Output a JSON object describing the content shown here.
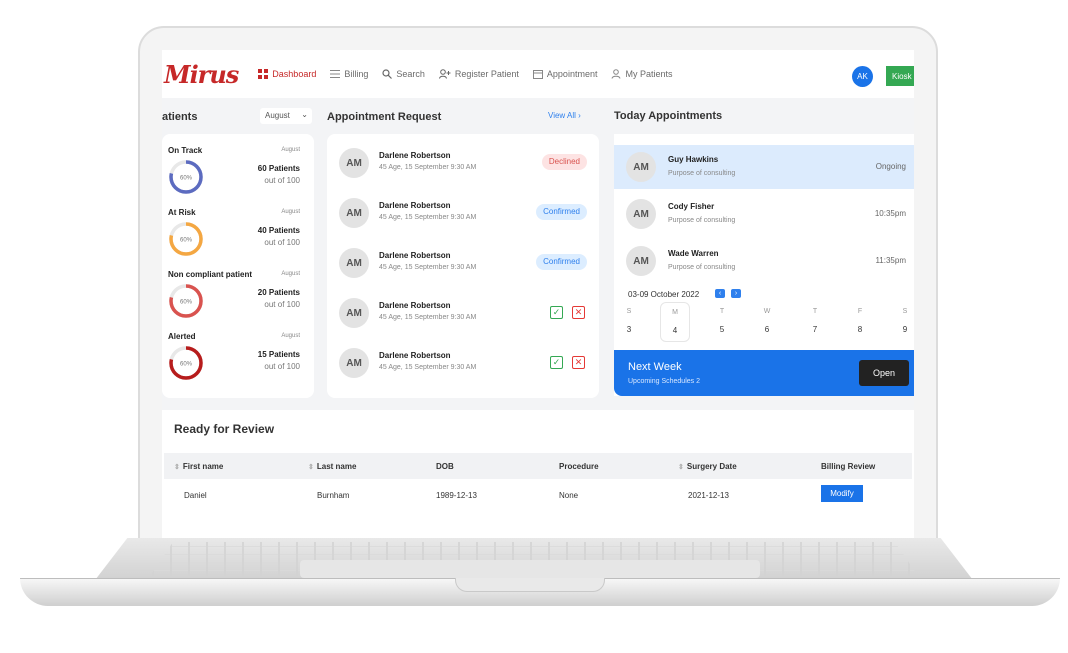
{
  "app": {
    "logo": "Mirus",
    "avatar_initials": "AK",
    "kiosk_label": "Kiosk"
  },
  "nav": {
    "items": [
      {
        "label": "Dashboard",
        "icon": "dashboard-icon",
        "active": true
      },
      {
        "label": "Billing",
        "icon": "list-icon"
      },
      {
        "label": "Search",
        "icon": "search-icon"
      },
      {
        "label": "Register Patient",
        "icon": "user-plus-icon"
      },
      {
        "label": "Appointment",
        "icon": "calendar-icon"
      },
      {
        "label": "My Patients",
        "icon": "user-icon"
      }
    ]
  },
  "patients": {
    "title": "atients",
    "month": "August",
    "metrics": [
      {
        "title": "On Track",
        "month": "August",
        "percent": "60%",
        "count": "60 Patients",
        "sub": "out of 100",
        "color": "#5c6bc0"
      },
      {
        "title": "At Risk",
        "month": "August",
        "percent": "60%",
        "count": "40 Patients",
        "sub": "out of 100",
        "color": "#f4a742"
      },
      {
        "title": "Non compliant patient",
        "month": "August",
        "percent": "60%",
        "count": "20 Patients",
        "sub": "out of 100",
        "color": "#d9534f"
      },
      {
        "title": "Alerted",
        "month": "August",
        "percent": "60%",
        "count": "15 Patients",
        "sub": "out of 100",
        "color": "#b71c1c"
      }
    ]
  },
  "requests": {
    "title": "Appointment Request",
    "view_all": "View All",
    "items": [
      {
        "initials": "AM",
        "name": "Darlene Robertson",
        "sub": "45 Age, 15 September 9:30 AM",
        "status": "Declined"
      },
      {
        "initials": "AM",
        "name": "Darlene Robertson",
        "sub": "45 Age, 15 September 9:30 AM",
        "status": "Confirmed"
      },
      {
        "initials": "AM",
        "name": "Darlene Robertson",
        "sub": "45 Age, 15 September 9:30 AM",
        "status": "Confirmed"
      },
      {
        "initials": "AM",
        "name": "Darlene Robertson",
        "sub": "45 Age, 15 September 9:30 AM",
        "status": ""
      },
      {
        "initials": "AM",
        "name": "Darlene Robertson",
        "sub": "45 Age, 15 September 9:30 AM",
        "status": ""
      }
    ]
  },
  "today": {
    "title": "Today Appointments",
    "items": [
      {
        "initials": "AM",
        "name": "Guy Hawkins",
        "sub": "Purpose of consulting",
        "time": "Ongoing"
      },
      {
        "initials": "AM",
        "name": "Cody Fisher",
        "sub": "Purpose of consulting",
        "time": "10:35pm"
      },
      {
        "initials": "AM",
        "name": "Wade Warren",
        "sub": "Purpose of consulting",
        "time": "11:35pm"
      }
    ],
    "week_range": "03-09 October 2022",
    "days": [
      {
        "l": "S",
        "n": "3"
      },
      {
        "l": "M",
        "n": "4"
      },
      {
        "l": "T",
        "n": "5"
      },
      {
        "l": "W",
        "n": "6"
      },
      {
        "l": "T",
        "n": "7"
      },
      {
        "l": "F",
        "n": "8"
      },
      {
        "l": "S",
        "n": "9"
      }
    ],
    "next_week": {
      "title": "Next Week",
      "sub": "Upcoming Schedules 2",
      "button": "Open"
    }
  },
  "review": {
    "title": "Ready for Review",
    "columns": [
      "First name",
      "Last name",
      "DOB",
      "Procedure",
      "Surgery Date",
      "Billing Review"
    ],
    "row": {
      "first": "Daniel",
      "last": "Burnham",
      "dob": "1989-12-13",
      "procedure": "None",
      "surgery": "2021-12-13",
      "action": "Modify"
    }
  }
}
